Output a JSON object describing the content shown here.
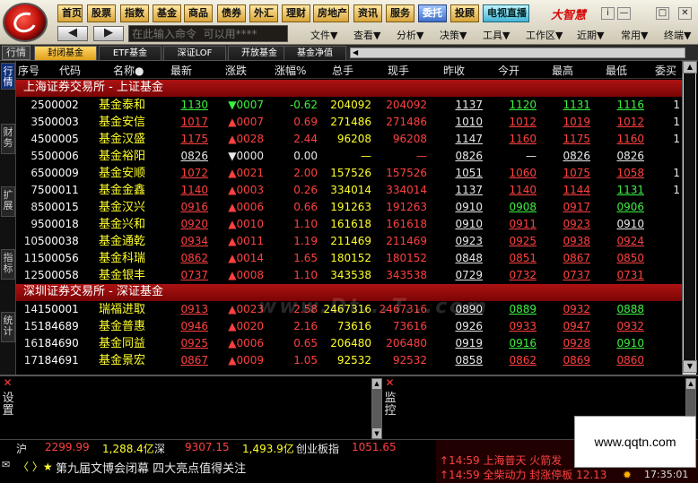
{
  "toolbar": {
    "buttons": [
      "首页",
      "股票",
      "指数",
      "基金",
      "商品",
      "债券",
      "外汇",
      "理财",
      "房地产",
      "资讯",
      "服务",
      "委托",
      "投顾",
      "电视直播"
    ],
    "brand": "大智慧",
    "command_placeholder": "在此输入命令  可以用****",
    "menu": [
      "文件▼",
      "查看▼",
      "分析▼",
      "决策▼",
      "工具▼",
      "工作区▼",
      "近期▼",
      "常用▼",
      "终端▼"
    ],
    "back": "◀",
    "forward": "▶",
    "win_controls": [
      "i",
      "—",
      "□",
      "✕"
    ]
  },
  "tabs": {
    "home": "行情",
    "items": [
      "封闭基金",
      "ETF基金",
      "深证LOF",
      "开放基金",
      "基金净值"
    ],
    "active": 0
  },
  "left_tabs": [
    "行情",
    "财务",
    "扩展",
    "指标",
    "统计"
  ],
  "table": {
    "headers": [
      "序号",
      "代码",
      "名称●",
      "最新",
      "涨跌",
      "涨幅%",
      "总手",
      "现手",
      "昨收",
      "今开",
      "最高",
      "最低",
      "委买"
    ],
    "sections": [
      {
        "title": "上海证券交易所 - 上证基金",
        "rows": [
          {
            "idx": "2",
            "code": "500002",
            "name": "基金泰和",
            "last": "1130",
            "chg": "▼0007",
            "pct": "-0.62",
            "vol": "204092",
            "cur": "204092",
            "prev": "1137",
            "open": "1120",
            "high": "1131",
            "low": "1116",
            "bid": "1"
          },
          {
            "idx": "3",
            "code": "500003",
            "name": "基金安信",
            "last": "1017",
            "chg": "▲0007",
            "pct": "0.69",
            "vol": "271486",
            "cur": "271486",
            "prev": "1010",
            "open": "1012",
            "high": "1019",
            "low": "1012",
            "bid": "1"
          },
          {
            "idx": "4",
            "code": "500005",
            "name": "基金汉盛",
            "last": "1175",
            "chg": "▲0028",
            "pct": "2.44",
            "vol": "96208",
            "cur": "96208",
            "prev": "1147",
            "open": "1160",
            "high": "1175",
            "low": "1160",
            "bid": "1"
          },
          {
            "idx": "5",
            "code": "500006",
            "name": "基金裕阳",
            "last": "0826",
            "chg": "▼0000",
            "pct": "0.00",
            "vol": "—",
            "cur": "—",
            "prev": "0826",
            "open": "—",
            "high": "0826",
            "low": "0826",
            "bid": ""
          },
          {
            "idx": "6",
            "code": "500009",
            "name": "基金安顺",
            "last": "1072",
            "chg": "▲0021",
            "pct": "2.00",
            "vol": "157526",
            "cur": "157526",
            "prev": "1051",
            "open": "1060",
            "high": "1075",
            "low": "1058",
            "bid": "1"
          },
          {
            "idx": "7",
            "code": "500011",
            "name": "基金金鑫",
            "last": "1140",
            "chg": "▲0003",
            "pct": "0.26",
            "vol": "334014",
            "cur": "334014",
            "prev": "1137",
            "open": "1140",
            "high": "1144",
            "low": "1131",
            "bid": "1"
          },
          {
            "idx": "8",
            "code": "500015",
            "name": "基金汉兴",
            "last": "0916",
            "chg": "▲0006",
            "pct": "0.66",
            "vol": "191263",
            "cur": "191263",
            "prev": "0910",
            "open": "0908",
            "high": "0917",
            "low": "0906",
            "bid": ""
          },
          {
            "idx": "9",
            "code": "500018",
            "name": "基金兴和",
            "last": "0920",
            "chg": "▲0010",
            "pct": "1.10",
            "vol": "161618",
            "cur": "161618",
            "prev": "0910",
            "open": "0911",
            "high": "0923",
            "low": "0910",
            "bid": ""
          },
          {
            "idx": "10",
            "code": "500038",
            "name": "基金通乾",
            "last": "0934",
            "chg": "▲0011",
            "pct": "1.19",
            "vol": "211469",
            "cur": "211469",
            "prev": "0923",
            "open": "0925",
            "high": "0938",
            "low": "0924",
            "bid": ""
          },
          {
            "idx": "11",
            "code": "500056",
            "name": "基金科瑞",
            "last": "0862",
            "chg": "▲0014",
            "pct": "1.65",
            "vol": "180152",
            "cur": "180152",
            "prev": "0848",
            "open": "0851",
            "high": "0867",
            "low": "0850",
            "bid": ""
          },
          {
            "idx": "12",
            "code": "500058",
            "name": "基金银丰",
            "last": "0737",
            "chg": "▲0008",
            "pct": "1.10",
            "vol": "343538",
            "cur": "343538",
            "prev": "0729",
            "open": "0732",
            "high": "0737",
            "low": "0731",
            "bid": ""
          }
        ]
      },
      {
        "title": "深圳证券交易所 - 深证基金",
        "rows": [
          {
            "idx": "14",
            "code": "150001",
            "name": "瑞福进取",
            "last": "0913",
            "chg": "▲0023",
            "pct": "2.58",
            "vol": "2467316",
            "cur": "2467316",
            "prev": "0890",
            "open": "0889",
            "high": "0932",
            "low": "0888",
            "bid": ""
          },
          {
            "idx": "15",
            "code": "184689",
            "name": "基金普惠",
            "last": "0946",
            "chg": "▲0020",
            "pct": "2.16",
            "vol": "73616",
            "cur": "73616",
            "prev": "0926",
            "open": "0933",
            "high": "0947",
            "low": "0932",
            "bid": ""
          },
          {
            "idx": "16",
            "code": "184690",
            "name": "基金同益",
            "last": "0925",
            "chg": "▲0006",
            "pct": "0.65",
            "vol": "206480",
            "cur": "206480",
            "prev": "0919",
            "open": "0916",
            "high": "0928",
            "low": "0910",
            "bid": ""
          },
          {
            "idx": "17",
            "code": "184691",
            "name": "基金景宏",
            "last": "0867",
            "chg": "▲0009",
            "pct": "1.05",
            "vol": "92532",
            "cur": "92532",
            "prev": "0858",
            "open": "0862",
            "high": "0869",
            "low": "0860",
            "bid": ""
          }
        ]
      }
    ]
  },
  "watermark": "www.Dt...T...com",
  "bottom": {
    "left_label": "设置",
    "right_label": "监控",
    "close": "✕"
  },
  "status": {
    "sh_label": "沪",
    "sh_value": "2299.99",
    "sh_amount": "1,288.4亿",
    "sz_label": "深",
    "sz_value": "9307.15",
    "sz_amount": "1,493.9亿",
    "cy_label": "创业板指",
    "cy_value": "1051.65",
    "news_nav": "〈 〉★",
    "news": "第九届文博会闭幕 四大亮点值得关注",
    "ticker1": "↑14:59 上海普天 火箭发",
    "ticker2": "↑14:59 全柴动力 封涨停板 12.13",
    "clock": "17:35:01"
  },
  "site_badge": "www.qqtn.com"
}
